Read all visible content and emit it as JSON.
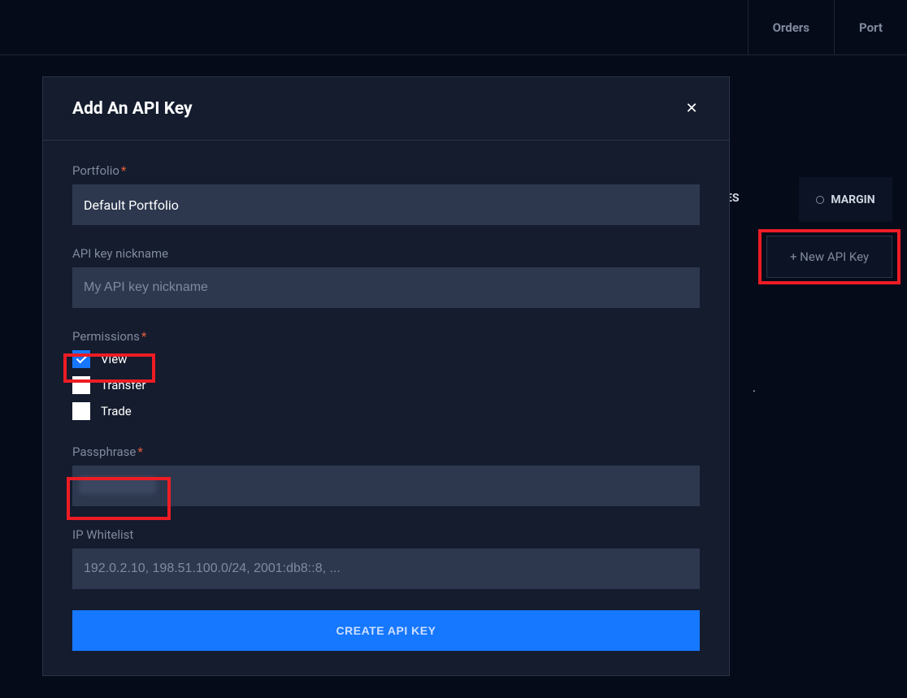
{
  "topbar": {
    "orders": "Orders",
    "portfolios": "Port"
  },
  "background": {
    "tab_margin": "MARGIN",
    "ees_fragment": "ES",
    "new_api_key": "+ New API Key",
    "trailing_dot": "."
  },
  "modal": {
    "title": "Add An API Key",
    "portfolio": {
      "label": "Portfolio",
      "value": "Default Portfolio"
    },
    "nickname": {
      "label": "API key nickname",
      "placeholder": "My API key nickname",
      "value": ""
    },
    "permissions": {
      "label": "Permissions",
      "options": [
        {
          "label": "View",
          "checked": true
        },
        {
          "label": "Transfer",
          "checked": false
        },
        {
          "label": "Trade",
          "checked": false
        }
      ]
    },
    "passphrase": {
      "label": "Passphrase",
      "value": ""
    },
    "ip_whitelist": {
      "label": "IP Whitelist",
      "placeholder": "192.0.2.10, 198.51.100.0/24, 2001:db8::8, ...",
      "value": ""
    },
    "create_button": "CREATE API KEY"
  }
}
